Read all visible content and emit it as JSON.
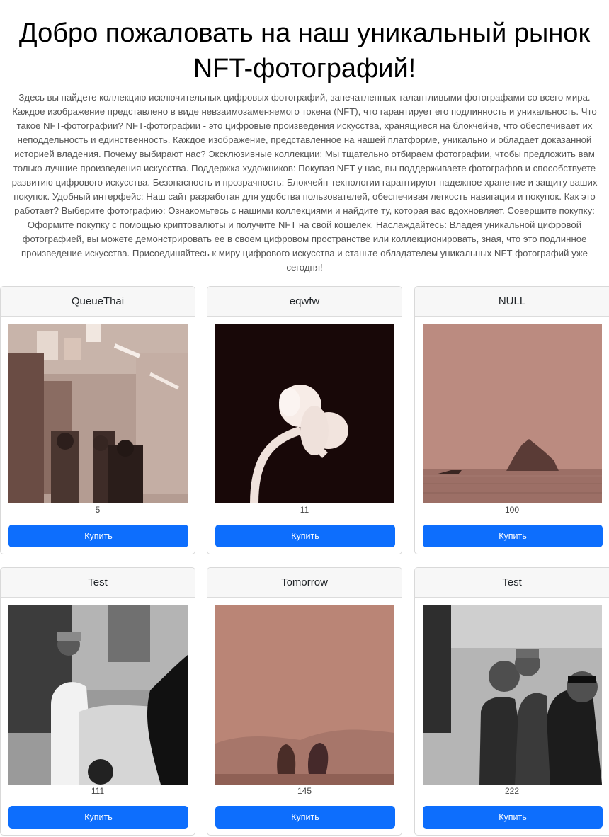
{
  "hero": {
    "title": "Добро пожаловать на наш уникальный рынок NFT-фотографий!",
    "description": "Здесь вы найдете коллекцию исключительных цифровых фотографий, запечатленных талантливыми фотографами со всего мира. Каждое изображение представлено в виде невзаимозаменяемого токена (NFT), что гарантирует его подлинность и уникальность. Что такое NFT-фотографии? NFT-фотографии - это цифровые произведения искусства, хранящиеся на блокчейне, что обеспечивает их неподдельность и единственность. Каждое изображение, представленное на нашей платформе, уникально и обладает доказанной историей владения. Почему выбирают нас? Эксклюзивные коллекции: Мы тщательно отбираем фотографии, чтобы предложить вам только лучшие произведения искусства. Поддержка художников: Покупая NFT у нас, вы поддерживаете фотографов и способствуете развитию цифрового искусства. Безопасность и прозрачность: Блокчейн-технологии гарантируют надежное хранение и защиту ваших покупок. Удобный интерфейс: Наш сайт разработан для удобства пользователей, обеспечивая легкость навигации и покупок. Как это работает? Выберите фотографию: Ознакомьтесь с нашими коллекциями и найдите ту, которая вас вдохновляет. Совершите покупку: Оформите покупку с помощью криптовалюты и получите NFT на свой кошелек. Наслаждайтесь: Владея уникальной цифровой фотографией, вы можете демонстрировать ее в своем цифровом пространстве или коллекционировать, зная, что это подлинное произведение искусства. Присоединяйтесь к миру цифрового искусства и станьте обладателем уникальных NFT-фотографий уже сегодня!"
  },
  "cards": [
    {
      "title": "QueueThai",
      "price": "5",
      "buy_label": "Купить",
      "photo": "store-aisle-sepia"
    },
    {
      "title": "eqwfw",
      "price": "11",
      "buy_label": "Купить",
      "photo": "butterfly-lamp-dark"
    },
    {
      "title": "NULL",
      "price": "100",
      "buy_label": "Купить",
      "photo": "sea-rock-boat-sepia"
    },
    {
      "title": "Test",
      "price": "111",
      "buy_label": "Купить",
      "photo": "street-man-cap-bw"
    },
    {
      "title": "Tomorrow",
      "price": "145",
      "buy_label": "Купить",
      "photo": "bay-islands-sepia"
    },
    {
      "title": "Test",
      "price": "222",
      "buy_label": "Купить",
      "photo": "street-men-bw"
    }
  ],
  "colors": {
    "primary": "#0d6efd",
    "card_header": "#f7f7f7",
    "card_border": "#d9d9d9"
  }
}
